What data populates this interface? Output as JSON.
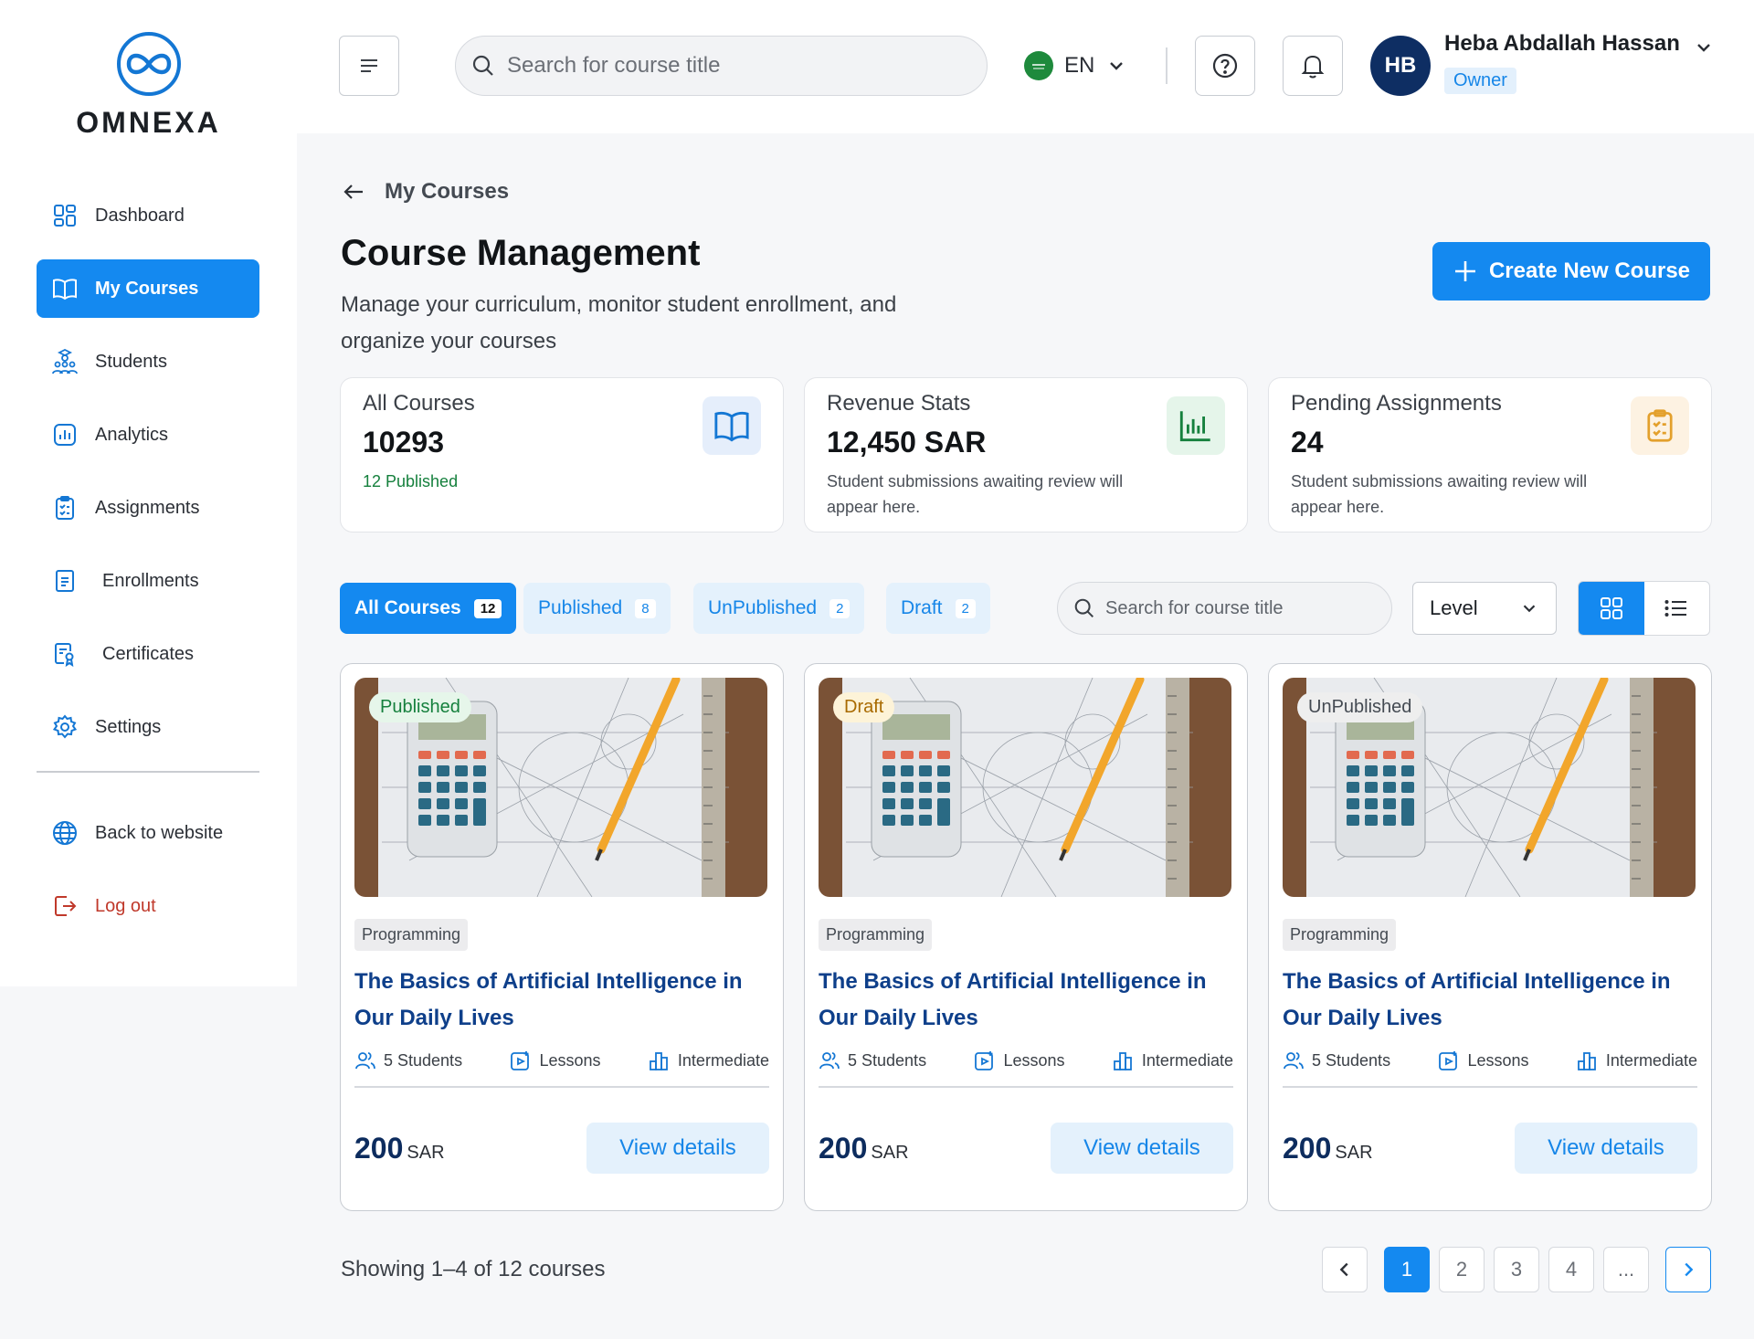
{
  "brand": {
    "name": "OMNEXA"
  },
  "sidebar": {
    "items": [
      {
        "label": "Dashboard",
        "icon": "dashboard-icon"
      },
      {
        "label": "My Courses",
        "icon": "book-open-icon",
        "active": true
      },
      {
        "label": "Students",
        "icon": "students-icon"
      },
      {
        "label": "Analytics",
        "icon": "analytics-icon"
      },
      {
        "label": "Assignments",
        "icon": "clipboard-icon"
      },
      {
        "label": "Enrollments",
        "icon": "document-icon"
      },
      {
        "label": "Certificates",
        "icon": "certificate-icon"
      },
      {
        "label": "Settings",
        "icon": "gear-icon"
      }
    ],
    "footer": [
      {
        "label": "Back to website",
        "icon": "globe-icon"
      },
      {
        "label": "Log out",
        "icon": "logout-icon"
      }
    ]
  },
  "topbar": {
    "search_placeholder": "Search for course title",
    "language": "EN",
    "user": {
      "initials": "HB",
      "name": "Heba Abdallah Hassan",
      "role": "Owner"
    }
  },
  "page": {
    "breadcrumb": "My Courses",
    "title": "Course Management",
    "subtitle": "Manage your curriculum, monitor student enrollment, and organize your courses",
    "create_label": "Create New Course"
  },
  "stats": [
    {
      "label": "All Courses",
      "value": "10293",
      "note": "12 Published",
      "icon": "book-open-icon"
    },
    {
      "label": "Revenue Stats",
      "value": "12,450 SAR",
      "note": "Student submissions awaiting review will appear here.",
      "icon": "bar-chart-icon"
    },
    {
      "label": "Pending Assignments",
      "value": "24",
      "note": "Student submissions awaiting review will appear here.",
      "icon": "clipboard-icon"
    }
  ],
  "tabs": [
    {
      "label": "All Courses",
      "count": "12",
      "active": true
    },
    {
      "label": "Published",
      "count": "8"
    },
    {
      "label": "UnPublished",
      "count": "2"
    },
    {
      "label": "Draft",
      "count": "2"
    }
  ],
  "filters": {
    "search_placeholder": "Search for course title",
    "level_label": "Level"
  },
  "courses": [
    {
      "status": "Published",
      "category": "Programming",
      "title": "The Basics of Artificial Intelligence in Our Daily Lives",
      "students": "5 Students",
      "lessons": "Lessons",
      "level": "Intermediate",
      "price": "200",
      "currency": "SAR",
      "action": "View details"
    },
    {
      "status": "Draft",
      "category": "Programming",
      "title": "The Basics of Artificial Intelligence in Our Daily Lives",
      "students": "5 Students",
      "lessons": "Lessons",
      "level": "Intermediate",
      "price": "200",
      "currency": "SAR",
      "action": "View details"
    },
    {
      "status": "UnPublished",
      "category": "Programming",
      "title": "The Basics of Artificial Intelligence in Our Daily Lives",
      "students": "5 Students",
      "lessons": "Lessons",
      "level": "Intermediate",
      "price": "200",
      "currency": "SAR",
      "action": "View details"
    }
  ],
  "pagination": {
    "showing": "Showing 1–4 of 12 courses",
    "pages": [
      "1",
      "2",
      "3",
      "4",
      "..."
    ],
    "current": "1"
  },
  "colors": {
    "primary": "#1489f0",
    "published_bg": "#e6f6ea",
    "published_fg": "#15803d",
    "draft_bg": "#fdf3d8",
    "draft_fg": "#a86a00",
    "unpublished_bg": "#eeeeee",
    "unpublished_fg": "#444a52"
  }
}
